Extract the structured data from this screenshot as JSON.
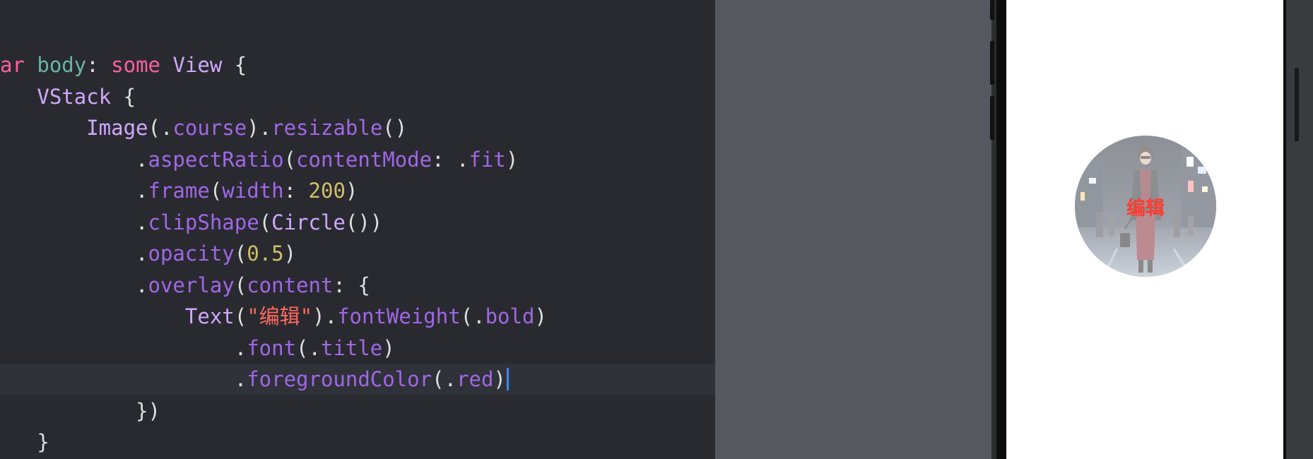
{
  "colors": {
    "editor_bg": "#292a30",
    "current_line_bg": "#2f3239",
    "keyword": "#fc5fa3",
    "type": "#d0a8ff",
    "property": "#67b7a4",
    "method": "#a167e6",
    "number": "#d0bf69",
    "string": "#fc6a5d",
    "plain": "#dfdfe0",
    "cursor": "#3b86ff",
    "canvas_bg": "#55595f",
    "preview_text": "#ff3b30"
  },
  "code": {
    "lines": [
      [
        {
          "t": "ar",
          "c": "keyword"
        },
        {
          "t": " "
        },
        {
          "t": "body",
          "c": "property"
        },
        {
          "t": ": "
        },
        {
          "t": "some",
          "c": "keyword"
        },
        {
          "t": " "
        },
        {
          "t": "View",
          "c": "type"
        },
        {
          "t": " {"
        }
      ],
      [
        {
          "t": "   "
        },
        {
          "t": "VStack",
          "c": "type"
        },
        {
          "t": " {"
        }
      ],
      [
        {
          "t": "       "
        },
        {
          "t": "Image",
          "c": "type"
        },
        {
          "t": "(."
        },
        {
          "t": "course",
          "c": "method"
        },
        {
          "t": ")."
        },
        {
          "t": "resizable",
          "c": "method"
        },
        {
          "t": "()"
        }
      ],
      [
        {
          "t": "           ."
        },
        {
          "t": "aspectRatio",
          "c": "method"
        },
        {
          "t": "("
        },
        {
          "t": "contentMode",
          "c": "method"
        },
        {
          "t": ": ."
        },
        {
          "t": "fit",
          "c": "method"
        },
        {
          "t": ")"
        }
      ],
      [
        {
          "t": "           ."
        },
        {
          "t": "frame",
          "c": "method"
        },
        {
          "t": "("
        },
        {
          "t": "width",
          "c": "method"
        },
        {
          "t": ": "
        },
        {
          "t": "200",
          "c": "number"
        },
        {
          "t": ")"
        }
      ],
      [
        {
          "t": "           ."
        },
        {
          "t": "clipShape",
          "c": "method"
        },
        {
          "t": "("
        },
        {
          "t": "Circle",
          "c": "type"
        },
        {
          "t": "())"
        }
      ],
      [
        {
          "t": "           ."
        },
        {
          "t": "opacity",
          "c": "method"
        },
        {
          "t": "("
        },
        {
          "t": "0.5",
          "c": "number"
        },
        {
          "t": ")"
        }
      ],
      [
        {
          "t": "           ."
        },
        {
          "t": "overlay",
          "c": "method"
        },
        {
          "t": "("
        },
        {
          "t": "content",
          "c": "method"
        },
        {
          "t": ": {"
        }
      ],
      [
        {
          "t": "               "
        },
        {
          "t": "Text",
          "c": "type"
        },
        {
          "t": "("
        },
        {
          "t": "\"编辑\"",
          "c": "string"
        },
        {
          "t": ")."
        },
        {
          "t": "fontWeight",
          "c": "method"
        },
        {
          "t": "(."
        },
        {
          "t": "bold",
          "c": "method"
        },
        {
          "t": ")"
        }
      ],
      [
        {
          "t": "                   ."
        },
        {
          "t": "font",
          "c": "method"
        },
        {
          "t": "(."
        },
        {
          "t": "title",
          "c": "method"
        },
        {
          "t": ")"
        }
      ],
      [
        {
          "t": "                   ."
        },
        {
          "t": "foregroundColor",
          "c": "method"
        },
        {
          "t": "(."
        },
        {
          "t": "red",
          "c": "method"
        },
        {
          "t": ")"
        }
      ],
      [
        {
          "t": "           })"
        }
      ],
      [
        {
          "t": "   }"
        }
      ]
    ],
    "current_line": 10
  },
  "preview": {
    "overlay_text": "编辑"
  }
}
